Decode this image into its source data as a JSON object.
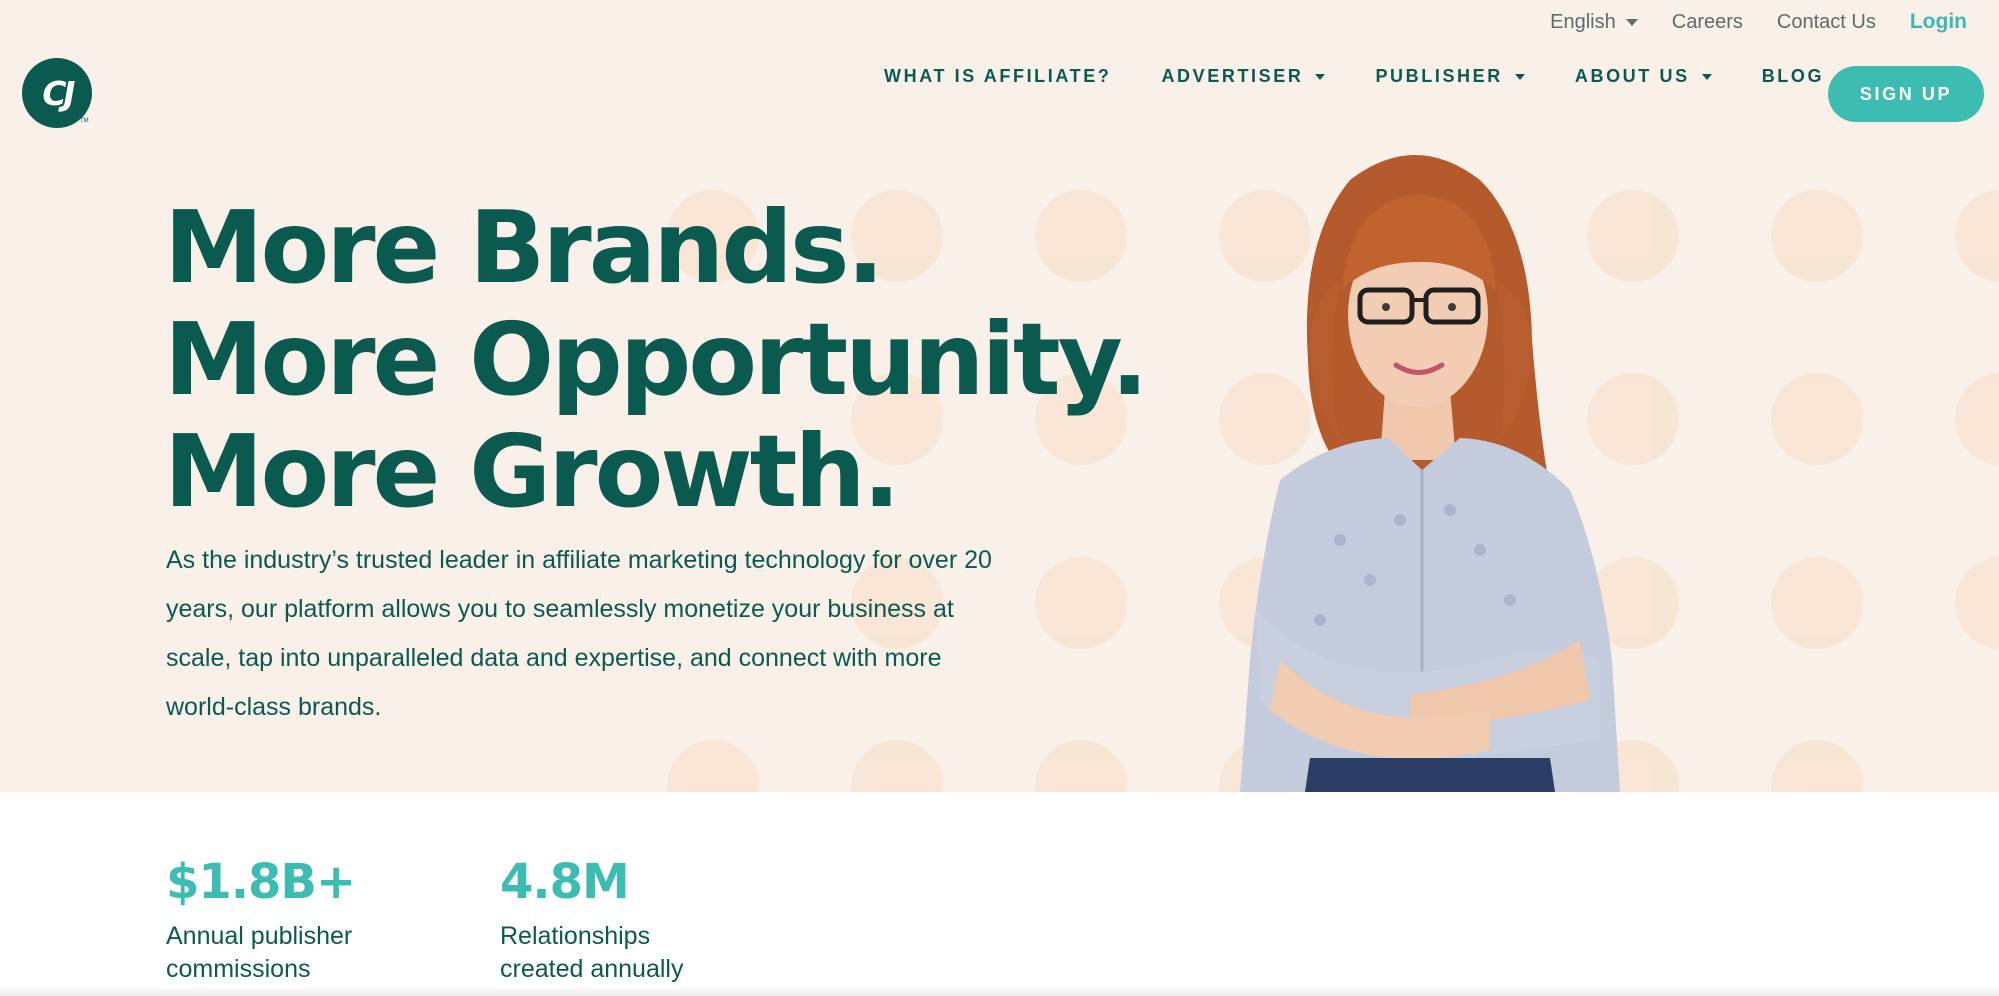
{
  "utility_nav": {
    "language": "English",
    "careers": "Careers",
    "contact": "Contact Us",
    "login": "Login"
  },
  "logo": {
    "mark": "CJ",
    "tm": "TM"
  },
  "main_nav": {
    "items": [
      {
        "label": "WHAT IS AFFILIATE?",
        "has_dropdown": false
      },
      {
        "label": "ADVERTISER",
        "has_dropdown": true
      },
      {
        "label": "PUBLISHER",
        "has_dropdown": true
      },
      {
        "label": "ABOUT US",
        "has_dropdown": true
      },
      {
        "label": "BLOG",
        "has_dropdown": false
      }
    ],
    "signup": "SIGN UP"
  },
  "hero": {
    "headline": [
      "More Brands.",
      "More Opportunity.",
      "More Growth."
    ],
    "intro": "As the industry’s trusted leader in affiliate marketing technology for over 20 years, our platform allows you to seamlessly monetize your business at scale, tap into unparalleled data and expertise, and connect with more world-class brands."
  },
  "stats": [
    {
      "value": "$1.8B+",
      "label": "Annual publisher commissions"
    },
    {
      "value": "4.8M",
      "label": "Relationships created annually"
    }
  ],
  "colors": {
    "brand_dark_green": "#0b5a50",
    "accent_teal": "#3dbdb2",
    "hero_background": "#f9f0ea",
    "dot_color": "#f8e3cf"
  },
  "icons": [
    "chevron-down-icon",
    "cj-logo-icon"
  ]
}
